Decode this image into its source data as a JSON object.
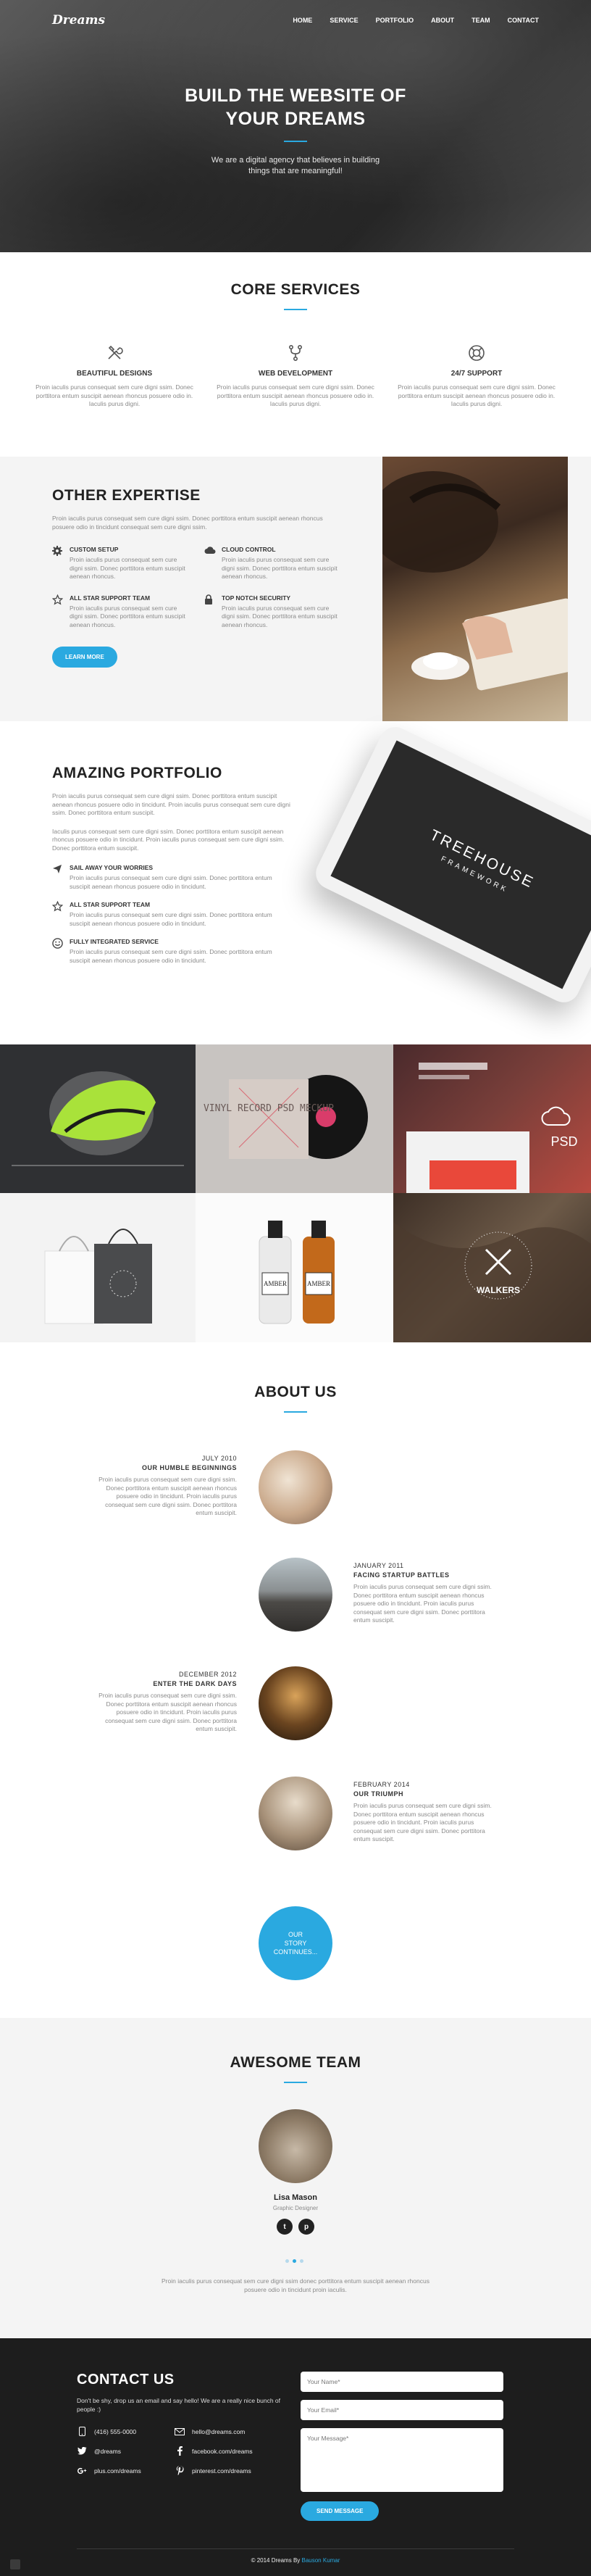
{
  "nav": {
    "logo": "Dreams",
    "items": [
      "HOME",
      "SERVICE",
      "PORTFOLIO",
      "ABOUT",
      "TEAM",
      "CONTACT"
    ]
  },
  "hero": {
    "title_line1": "BUILD THE WEBSITE OF",
    "title_line2": "YOUR DREAMS",
    "subtitle_line1": "We are a digital agency that believes in building",
    "subtitle_line2": "things that are meaningful!"
  },
  "services": {
    "title": "CORE SERVICES",
    "items": [
      {
        "icon": "tools-icon",
        "title": "BEAUTIFUL DESIGNS",
        "text": "Proin iaculis purus consequat sem cure digni ssim. Donec porttitora entum suscipit aenean rhoncus posuere odio in. Iaculis purus digni."
      },
      {
        "icon": "fork-icon",
        "title": "WEB DEVELOPMENT",
        "text": "Proin iaculis purus consequat sem cure digni ssim. Donec porttitora entum suscipit aenean rhoncus posuere odio in. Iaculis purus digni."
      },
      {
        "icon": "lifebuoy-icon",
        "title": "24/7 SUPPORT",
        "text": "Proin iaculis purus consequat sem cure digni ssim. Donec porttitora entum suscipit aenean rhoncus posuere odio in. Iaculis purus digni."
      }
    ]
  },
  "expertise": {
    "title": "OTHER EXPERTISE",
    "lead": "Proin iaculis purus consequat sem cure digni ssim. Donec porttitora entum suscipit aenean rhoncus posuere odio in tincidunt consequat sem cure digni ssim.",
    "features": [
      {
        "icon": "gear-icon",
        "title": "CUSTOM SETUP",
        "text": "Proin iaculis purus consequat sem cure digni ssim. Donec porttitora entum suscipit aenean rhoncus."
      },
      {
        "icon": "cloud-icon",
        "title": "CLOUD CONTROL",
        "text": "Proin iaculis purus consequat sem cure digni ssim. Donec porttitora entum suscipit aenean rhoncus."
      },
      {
        "icon": "star-icon",
        "title": "ALL STAR SUPPORT TEAM",
        "text": "Proin iaculis purus consequat sem cure digni ssim. Donec porttitora entum suscipit aenean rhoncus."
      },
      {
        "icon": "lock-icon",
        "title": "TOP NOTCH SECURITY",
        "text": "Proin iaculis purus consequat sem cure digni ssim. Donec porttitora entum suscipit aenean rhoncus."
      }
    ],
    "button": "LEARN MORE"
  },
  "portfolio": {
    "title": "AMAZING PORTFOLIO",
    "lead1": "Proin iaculis purus consequat sem cure digni ssim. Donec porttitora entum suscipit aenean rhoncus posuere odio in tincidunt. Proin iaculis purus consequat sem cure digni ssim. Donec porttitora entum suscipit.",
    "lead2": "Iaculis purus consequat sem cure digni ssim. Donec porttitora entum suscipit aenean rhoncus posuere odio in tincidunt. Proin iaculis purus consequat sem cure digni ssim. Donec porttitora entum suscipit.",
    "features": [
      {
        "icon": "send-icon",
        "title": "SAIL AWAY YOUR WORRIES",
        "text": "Proin iaculis purus consequat sem cure digni ssim. Donec porttitora entum suscipit aenean rhoncus posuere odio in tincidunt."
      },
      {
        "icon": "star-icon",
        "title": "ALL STAR SUPPORT TEAM",
        "text": "Proin iaculis purus consequat sem cure digni ssim. Donec porttitora entum suscipit aenean rhoncus posuere odio in tincidunt."
      },
      {
        "icon": "smile-icon",
        "title": "FULLY INTEGRATED SERVICE",
        "text": "Proin iaculis purus consequat sem cure digni ssim. Donec porttitora entum suscipit aenean rhoncus posuere odio in tincidunt."
      }
    ],
    "tablet_title": "TREEHOUSE",
    "tablet_sub": "FRAMEWORK",
    "gallery": {
      "vinyl": "VINYL RECORD PSD MECKUP",
      "psd": "PSD",
      "amber": "AMBER",
      "walkers": "WALKERS"
    }
  },
  "about": {
    "title": "ABOUT US",
    "events": [
      {
        "date": "JULY 2010",
        "title": "OUR HUMBLE BEGINNINGS",
        "text": "Proin iaculis purus consequat sem cure digni ssim. Donec porttitora entum suscipit aenean rhoncus posuere odio in tincidunt. Proin iaculis purus consequat sem cure digni ssim. Donec porttitora entum suscipit."
      },
      {
        "date": "JANUARY 2011",
        "title": "FACING STARTUP BATTLES",
        "text": "Proin iaculis purus consequat sem cure digni ssim. Donec porttitora entum suscipit aenean rhoncus posuere odio in tincidunt. Proin iaculis purus consequat sem cure digni ssim. Donec porttitora entum suscipit."
      },
      {
        "date": "DECEMBER 2012",
        "title": "ENTER THE DARK DAYS",
        "text": "Proin iaculis purus consequat sem cure digni ssim. Donec porttitora entum suscipit aenean rhoncus posuere odio in tincidunt. Proin iaculis purus consequat sem cure digni ssim. Donec porttitora entum suscipit."
      },
      {
        "date": "FEBRUARY 2014",
        "title": "OUR TRIUMPH",
        "text": "Proin iaculis purus consequat sem cure digni ssim. Donec porttitora entum suscipit aenean rhoncus posuere odio in tincidunt. Proin iaculis purus consequat sem cure digni ssim. Donec porttitora entum suscipit."
      }
    ],
    "story": [
      "OUR",
      "STORY",
      "CONTINUES..."
    ]
  },
  "team": {
    "title": "AWESOME TEAM",
    "name": "Lisa Mason",
    "role": "Graphic Designer",
    "socials": [
      "t",
      "p"
    ],
    "note1": "Proin iaculis purus consequat sem cure digni ssim donec porttitora entum suscipit aenean rhoncus",
    "note2": "posuere odio in tincidunt proin iaculis."
  },
  "contact": {
    "title": "CONTACT US",
    "intro": "Don't be shy, drop us an email and say hello! We are a really nice bunch of people :)",
    "items": [
      {
        "icon": "phone-icon",
        "text": "(416) 555-0000"
      },
      {
        "icon": "mail-icon",
        "text": "hello@dreams.com"
      },
      {
        "icon": "twitter-icon",
        "text": "@dreams"
      },
      {
        "icon": "facebook-icon",
        "text": "facebook.com/dreams"
      },
      {
        "icon": "google-plus-icon",
        "text": "plus.com/dreams"
      },
      {
        "icon": "pinterest-icon",
        "text": "pinterest.com/dreams"
      }
    ],
    "name_ph": "Your Name*",
    "email_ph": "Your Email*",
    "message_ph": "Your Message*",
    "send": "SEND MESSAGE"
  },
  "footer": {
    "copy": "© 2014 Dreams By ",
    "author": "Bauson Kumar"
  },
  "colors": {
    "accent": "#2aa9e0",
    "dark": "#1d1d1d",
    "light": "#f4f4f4"
  }
}
